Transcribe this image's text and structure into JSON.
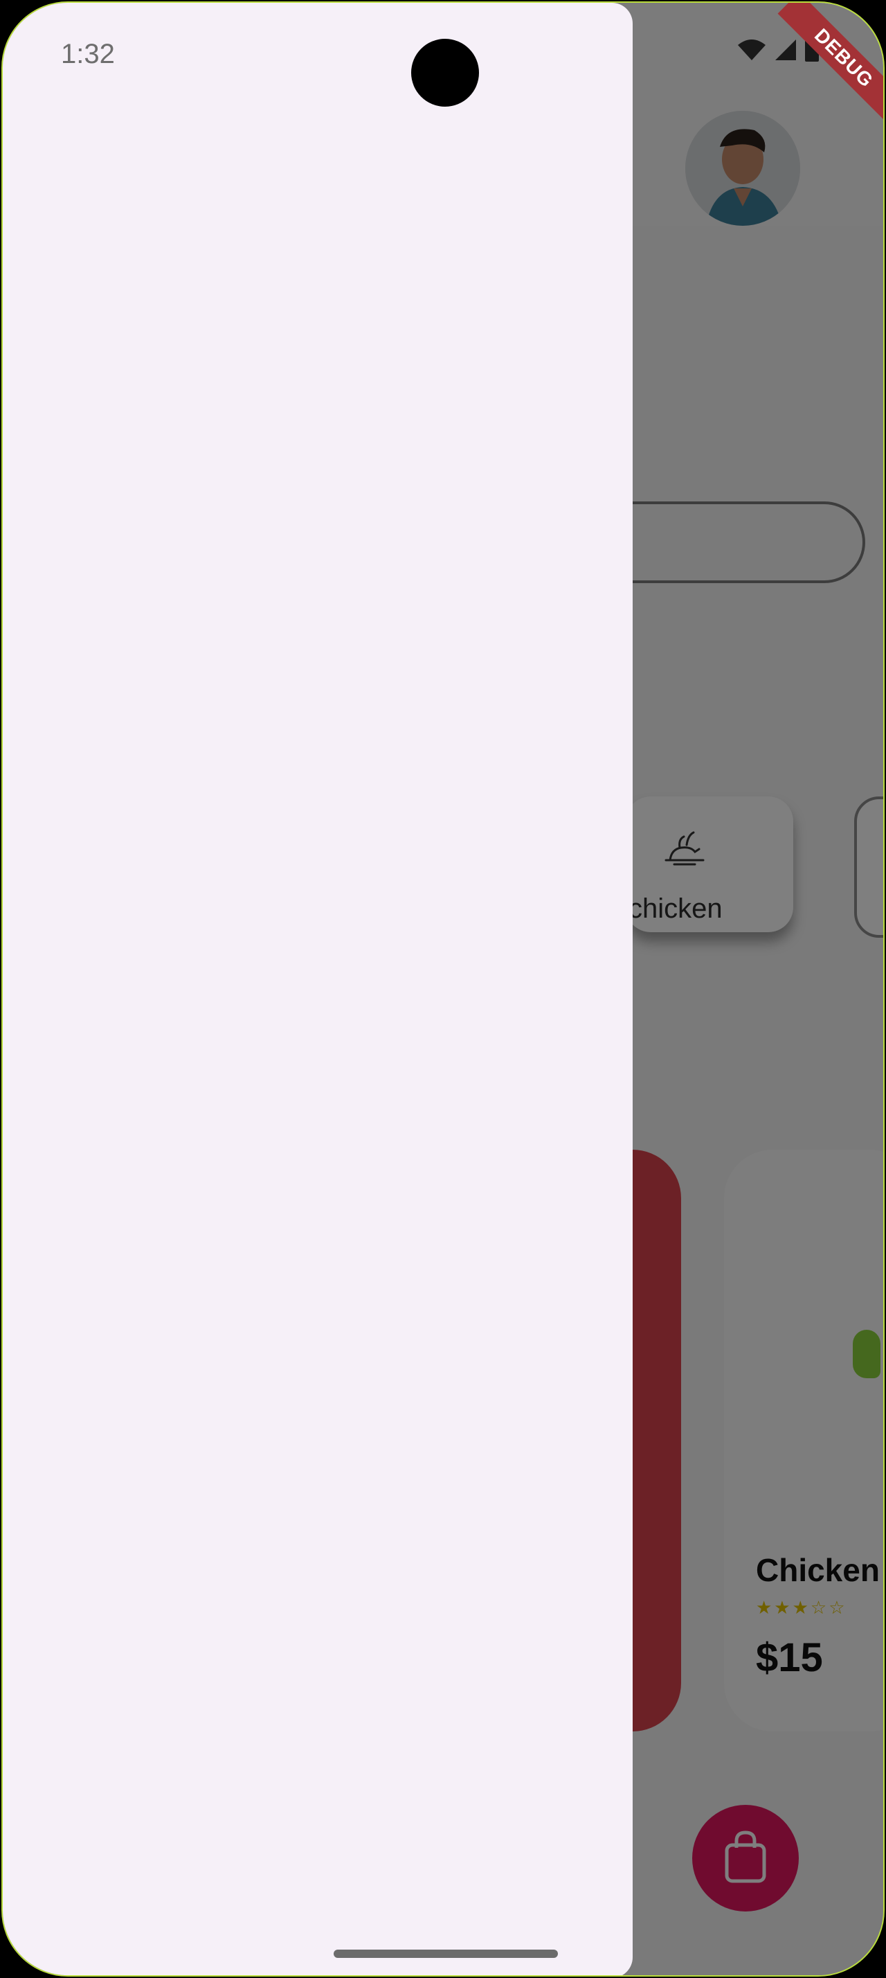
{
  "status_bar": {
    "time": "1:32"
  },
  "debug_banner": {
    "label": "DEBUG"
  },
  "categories": [
    {
      "label": "chicken",
      "icon": "chicken-icon"
    }
  ],
  "food_card": {
    "title": "Chicken",
    "price": "$15",
    "rating": 3,
    "rating_max": 5
  },
  "cart_button": {
    "icon": "shopping-bag-icon"
  },
  "colors": {
    "accent": "#e1175f",
    "card_red": "#d9434c",
    "drawer": "#f6f0f8",
    "star": "#e0c000"
  }
}
